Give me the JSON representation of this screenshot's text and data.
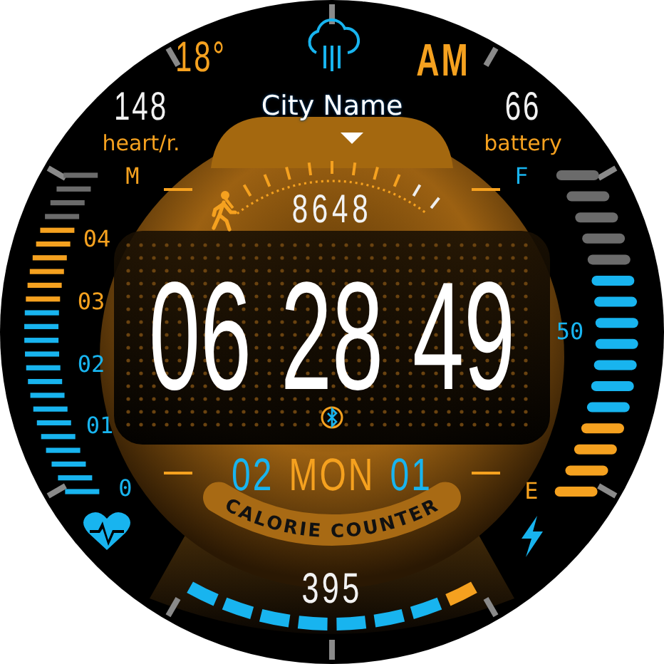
{
  "weather": {
    "temperature": "18°"
  },
  "period": "AM",
  "heart_rate": {
    "value": "148",
    "label": "heart/r."
  },
  "city": "City Name",
  "battery": {
    "value": "66",
    "label": "battery"
  },
  "heart_gauge": {
    "level": 0.83,
    "labels": [
      {
        "text": "M",
        "color": "#f5a11f"
      },
      {
        "text": "04",
        "color": "#f5a11f"
      },
      {
        "text": "03",
        "color": "#f5a11f"
      },
      {
        "text": "02",
        "color": "#18b4ef"
      },
      {
        "text": "01",
        "color": "#18b4ef"
      },
      {
        "text": "0",
        "color": "#18b4ef"
      }
    ]
  },
  "battery_gauge": {
    "level": 0.69,
    "labels": [
      {
        "text": "F",
        "color": "#18b4ef"
      },
      {
        "text": "50",
        "color": "#18b4ef"
      },
      {
        "text": "E",
        "color": "#f5a11f"
      }
    ]
  },
  "steps": "8648",
  "time": {
    "hours": "06",
    "minutes": "28",
    "seconds": "49"
  },
  "date": {
    "day": "02",
    "weekday": "MON",
    "month": "01"
  },
  "calories": {
    "title": "CALORIE COUNTER",
    "value": "395"
  }
}
